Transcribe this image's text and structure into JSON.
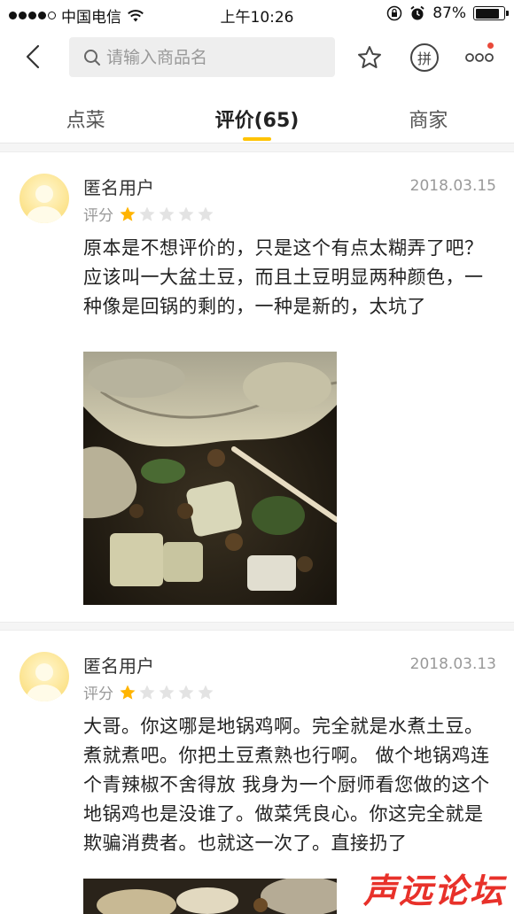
{
  "status_bar": {
    "carrier": "中国电信",
    "time": "上午10:26",
    "battery": "87%",
    "battery_level": 0.87
  },
  "nav": {
    "search_placeholder": "请输入商品名",
    "pin_label": "拼"
  },
  "tabs": [
    {
      "label": "点菜",
      "active": false
    },
    {
      "label": "评价(65)",
      "active": true
    },
    {
      "label": "商家",
      "active": false
    }
  ],
  "rating_label": "评分",
  "reviews": [
    {
      "user": "匿名用户",
      "date": "2018.03.15",
      "stars": 1,
      "text": "原本是不想评价的，只是这个有点太糊弄了吧？应该叫一大盆土豆，而且土豆明显两种颜色，一种像是回锅的剩的，一种是新的，太坑了"
    },
    {
      "user": "匿名用户",
      "date": "2018.03.13",
      "stars": 1,
      "text": "大哥。你这哪是地锅鸡啊。完全就是水煮土豆。煮就煮吧。你把土豆煮熟也行啊。 做个地锅鸡连个青辣椒不舍得放  我身为一个厨师看您做的这个地锅鸡也是没谁了。做菜凭良心。你这完全就是欺骗消费者。也就这一次了。直接扔了"
    }
  ],
  "watermark": "声远论坛",
  "colors": {
    "accent": "#ffc300",
    "star_on": "#ffb400",
    "star_off": "#e3e3e3",
    "watermark": "#e8312a"
  }
}
